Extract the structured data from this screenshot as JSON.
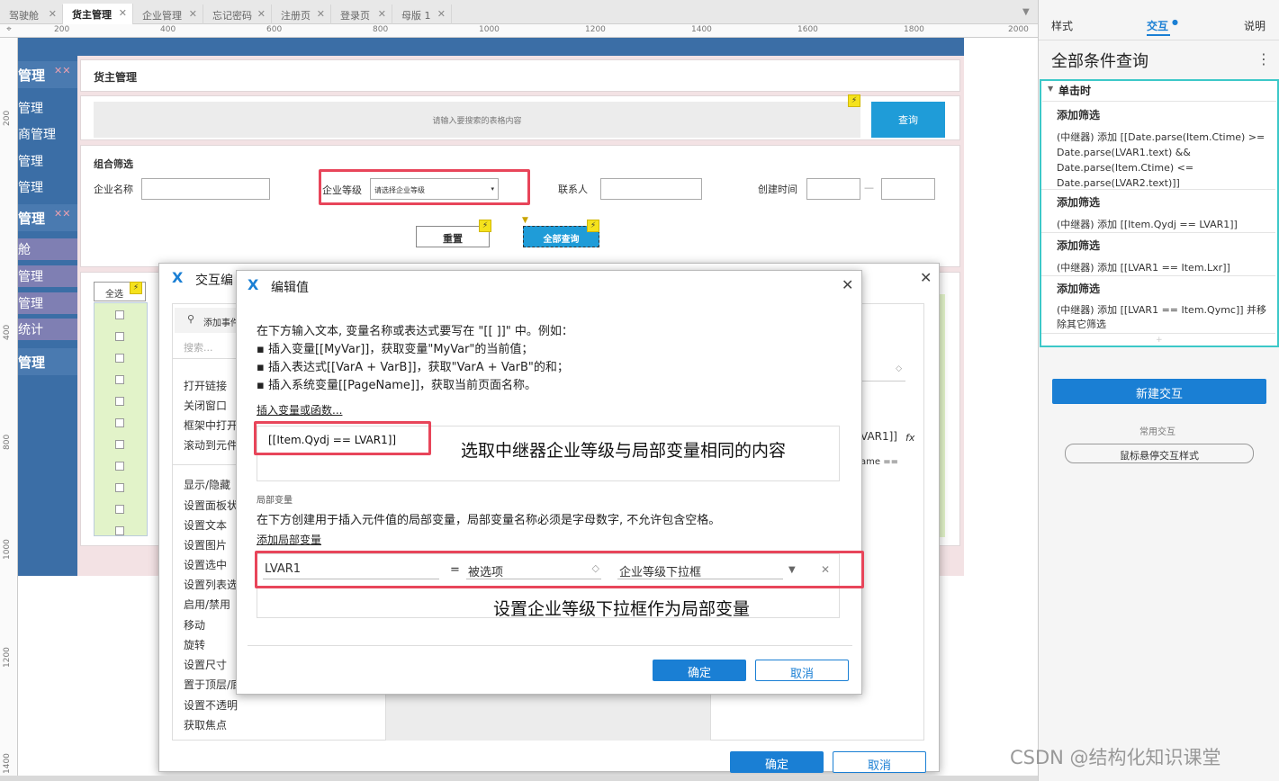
{
  "tabs": [
    "驾驶舱",
    "货主管理",
    "企业管理",
    "忘记密码",
    "注册页",
    "登录页",
    "母版 1"
  ],
  "active_tab_index": 1,
  "ruler_h": [
    "200",
    "400",
    "600",
    "800",
    "1000",
    "1200",
    "1400",
    "1600",
    "1800",
    "2000"
  ],
  "ruler_v": [
    "200",
    "400",
    "600",
    "800",
    "1000",
    "1200",
    "1400"
  ],
  "sidenav": {
    "items": [
      "管理",
      "管理",
      "商管理",
      "管理",
      "管理",
      "管理",
      "舱",
      "管理",
      "管理",
      "统计",
      "管理"
    ]
  },
  "page": {
    "title": "货主管理",
    "search_placeholder": "请输入要搜索的表格内容",
    "search_button": "查询",
    "filter_title": "组合筛选",
    "field_company": "企业名称",
    "field_level": "企业等级",
    "level_placeholder": "请选择企业等级",
    "field_contact": "联系人",
    "field_created": "创建时间",
    "date_sep": "—",
    "reset_button": "重置",
    "query_all_button": "全部查询",
    "select_all": "全选"
  },
  "outer_dialog": {
    "title": "交互编",
    "add_event": "添加事件",
    "search_placeholder": "搜索...",
    "actions": [
      "打开链接",
      "关闭窗口",
      "框架中打开",
      "滚动到元件",
      "显示/隐藏",
      "设置面板状",
      "设置文本",
      "设置图片",
      "设置选中",
      "设置列表选",
      "启用/禁用",
      "移动",
      "旋转",
      "设置尺寸",
      "置于顶层/底",
      "设置不透明",
      "获取焦点"
    ],
    "partial_text": "VAR1]]",
    "fx": "fx",
    "partial_text2": "ame ==",
    "ok": "确定",
    "cancel": "取消"
  },
  "edit_dialog": {
    "title": "编辑值",
    "instructions": [
      "在下方输入文本, 变量名称或表达式要写在 \"[[ ]]\" 中。例如：",
      "▪ 插入变量[[MyVar]]，获取变量\"MyVar\"的当前值；",
      "▪ 插入表达式[[VarA + VarB]]，获取\"VarA + VarB\"的和；",
      "▪ 插入系统变量[[PageName]]，获取当前页面名称。"
    ],
    "insert_var_link": "插入变量或函数...",
    "expression": "[[Item.Qydj == LVAR1]]",
    "annotation1": "选取中继器企业等级与局部变量相同的内容",
    "local_var_heading": "局部变量",
    "local_var_desc": "在下方创建用于插入元件值的局部变量，局部变量名称必须是字母数字, 不允许包含空格。",
    "add_local_var": "添加局部变量",
    "var_name": "LVAR1",
    "equals": "=",
    "var_type": "被选项",
    "var_target": "企业等级下拉框",
    "annotation2": "设置企业等级下拉框作为局部变量",
    "ok": "确定",
    "cancel": "取消"
  },
  "right_panel": {
    "tabs": [
      "样式",
      "交互",
      "说明"
    ],
    "active_tab": "交互",
    "widget_name": "全部条件查询",
    "event": "单击时",
    "cases": [
      {
        "title": "添加筛选",
        "text": "(中继器) 添加 [[Date.parse(Item.Ctime) >= Date.parse(LVAR1.text) && Date.parse(Item.Ctime) <= Date.parse(LVAR2.text)]]"
      },
      {
        "title": "添加筛选",
        "text": "(中继器) 添加 [[Item.Qydj == LVAR1]]"
      },
      {
        "title": "添加筛选",
        "text": "(中继器) 添加 [[LVAR1 == Item.Lxr]]"
      },
      {
        "title": "添加筛选",
        "text": "(中继器) 添加 [[LVAR1 == Item.Qymc]] 并移除其它筛选"
      }
    ],
    "new_interaction": "新建交互",
    "common_label": "常用交互",
    "hover_style": "鼠标悬停交互样式"
  },
  "watermark": "CSDN @结构化知识课堂",
  "colors": {
    "accent": "#1a7fd4",
    "nav": "#3b6ea6",
    "highlight": "#e8455a",
    "teal": "#3cc8c8"
  }
}
